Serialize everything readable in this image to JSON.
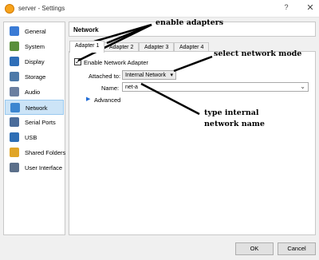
{
  "window": {
    "title": "server - Settings",
    "help": "?",
    "close": "✕"
  },
  "sidebar": {
    "items": [
      {
        "label": "General",
        "icon": "general-icon",
        "color": "#3a7bd5"
      },
      {
        "label": "System",
        "icon": "system-icon",
        "color": "#5a8f3c"
      },
      {
        "label": "Display",
        "icon": "display-icon",
        "color": "#2f6fb8"
      },
      {
        "label": "Storage",
        "icon": "storage-icon",
        "color": "#4d79a8"
      },
      {
        "label": "Audio",
        "icon": "audio-icon",
        "color": "#6b7fa0"
      },
      {
        "label": "Network",
        "icon": "network-icon",
        "color": "#3c86d0",
        "selected": true
      },
      {
        "label": "Serial Ports",
        "icon": "serial-ports-icon",
        "color": "#4a6c9b"
      },
      {
        "label": "USB",
        "icon": "usb-icon",
        "color": "#2e6eb5"
      },
      {
        "label": "Shared Folders",
        "icon": "shared-folders-icon",
        "color": "#e0a528"
      },
      {
        "label": "User Interface",
        "icon": "user-interface-icon",
        "color": "#5b6f8a"
      }
    ]
  },
  "section": {
    "title": "Network"
  },
  "tabs": [
    "Adapter 1",
    "Adapter 2",
    "Adapter 3",
    "Adapter 4"
  ],
  "adapter": {
    "enable_label": "Enable Network Adapter",
    "enabled": true,
    "check_mark": "✓",
    "attached_label": "Attached to:",
    "attached_value": "Internal Network",
    "attached_arrow": "▾",
    "name_label": "Name:",
    "name_value": "net-a",
    "name_arrow": "⌄",
    "advanced_label": "Advanced",
    "advanced_arrow": "▶"
  },
  "annotations": {
    "enable": "enable adapters",
    "select": "select network mode",
    "type_line1": "type internal",
    "type_line2": "network name"
  },
  "footer": {
    "ok": "OK",
    "cancel": "Cancel"
  }
}
